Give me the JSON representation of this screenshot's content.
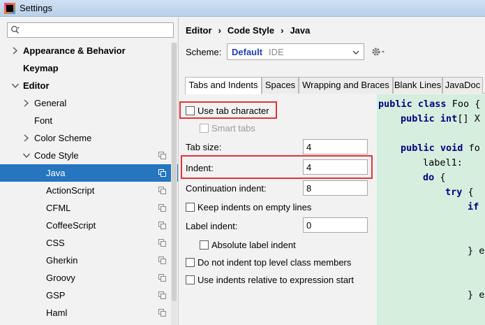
{
  "window": {
    "title": "Settings"
  },
  "sidebar": {
    "search": {
      "placeholder": "",
      "value": ""
    },
    "items": [
      {
        "label": "Appearance & Behavior",
        "level": 0,
        "arrow": "right",
        "bold": true
      },
      {
        "label": "Keymap",
        "level": 0,
        "arrow": "none",
        "bold": true
      },
      {
        "label": "Editor",
        "level": 0,
        "arrow": "down",
        "bold": true
      },
      {
        "label": "General",
        "level": 1,
        "arrow": "right"
      },
      {
        "label": "Font",
        "level": 1,
        "arrow": "none"
      },
      {
        "label": "Color Scheme",
        "level": 1,
        "arrow": "right"
      },
      {
        "label": "Code Style",
        "level": 1,
        "arrow": "down",
        "copy_icon": true
      },
      {
        "label": "Java",
        "level": 2,
        "selected": true,
        "copy_icon": true
      },
      {
        "label": "ActionScript",
        "level": 2,
        "copy_icon": true
      },
      {
        "label": "CFML",
        "level": 2,
        "copy_icon": true
      },
      {
        "label": "CoffeeScript",
        "level": 2,
        "copy_icon": true
      },
      {
        "label": "CSS",
        "level": 2,
        "copy_icon": true
      },
      {
        "label": "Gherkin",
        "level": 2,
        "copy_icon": true
      },
      {
        "label": "Groovy",
        "level": 2,
        "copy_icon": true
      },
      {
        "label": "GSP",
        "level": 2,
        "copy_icon": true
      },
      {
        "label": "Haml",
        "level": 2,
        "copy_icon": true
      }
    ]
  },
  "breadcrumb": {
    "parts": [
      "Editor",
      "Code Style",
      "Java"
    ],
    "separator": "›"
  },
  "scheme": {
    "label": "Scheme:",
    "name": "Default",
    "sub": "IDE"
  },
  "tabs": [
    {
      "label": "Tabs and Indents",
      "active": true
    },
    {
      "label": "Spaces"
    },
    {
      "label": "Wrapping and Braces"
    },
    {
      "label": "Blank Lines"
    },
    {
      "label": "JavaDoc"
    }
  ],
  "settings": {
    "use_tab_character": {
      "label": "Use tab character",
      "checked": false
    },
    "smart_tabs": {
      "label": "Smart tabs",
      "checked": false,
      "disabled": true
    },
    "tab_size": {
      "label": "Tab size:",
      "value": "4"
    },
    "indent": {
      "label": "Indent:",
      "value": "4"
    },
    "continuation_indent": {
      "label": "Continuation indent:",
      "value": "8"
    },
    "keep_indents_empty": {
      "label": "Keep indents on empty lines",
      "checked": false
    },
    "label_indent": {
      "label": "Label indent:",
      "value": "0"
    },
    "absolute_label_indent": {
      "label": "Absolute label indent",
      "checked": false
    },
    "no_indent_top_level": {
      "label": "Do not indent top level class members",
      "checked": false
    },
    "indents_relative_expr": {
      "label": "Use indents relative to expression start",
      "checked": false
    }
  },
  "code_preview": {
    "lines": [
      "public class Foo {",
      "public int[] X",
      "public void fo",
      "label1:",
      "do {",
      "try {",
      "if",
      "} e",
      "} e"
    ]
  },
  "colors": {
    "selection": "#2675bf",
    "highlight_box": "#e0343c",
    "code_bg": "#d6eedd",
    "keyword": "#000080"
  }
}
